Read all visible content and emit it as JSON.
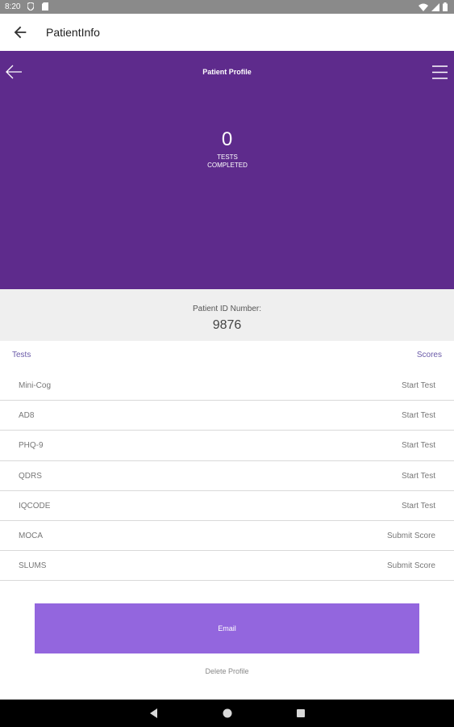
{
  "status_bar": {
    "time": "8:20",
    "icons": [
      "shield-icon",
      "sd-card-icon",
      "wifi-icon",
      "signal-icon",
      "battery-icon"
    ]
  },
  "app_bar": {
    "title": "PatientInfo",
    "back_icon": "arrow-left-icon"
  },
  "header": {
    "title": "Patient Profile",
    "tests_completed_count": "0",
    "tests_completed_label_line1": "TESTS",
    "tests_completed_label_line2": "COMPLETED",
    "background_color": "#5e2b8c",
    "icons": [
      "arrow-left-icon",
      "menu-icon"
    ]
  },
  "patient": {
    "id_label": "Patient ID Number:",
    "id_value": "9876"
  },
  "table": {
    "tests_header": "Tests",
    "scores_header": "Scores",
    "rows": [
      {
        "name": "Mini-Cog",
        "action": "Start Test"
      },
      {
        "name": "AD8",
        "action": "Start Test"
      },
      {
        "name": "PHQ-9",
        "action": "Start Test"
      },
      {
        "name": "QDRS",
        "action": "Start Test"
      },
      {
        "name": "IQCODE",
        "action": "Start Test"
      },
      {
        "name": "MOCA",
        "action": "Submit Score"
      },
      {
        "name": "SLUMS",
        "action": "Submit Score"
      }
    ]
  },
  "actions": {
    "email_label": "Email",
    "email_color": "#9366de",
    "delete_label": "Delete Profile"
  },
  "nav_bar": {
    "icons": [
      "back-triangle-icon",
      "home-circle-icon",
      "recents-square-icon"
    ]
  }
}
